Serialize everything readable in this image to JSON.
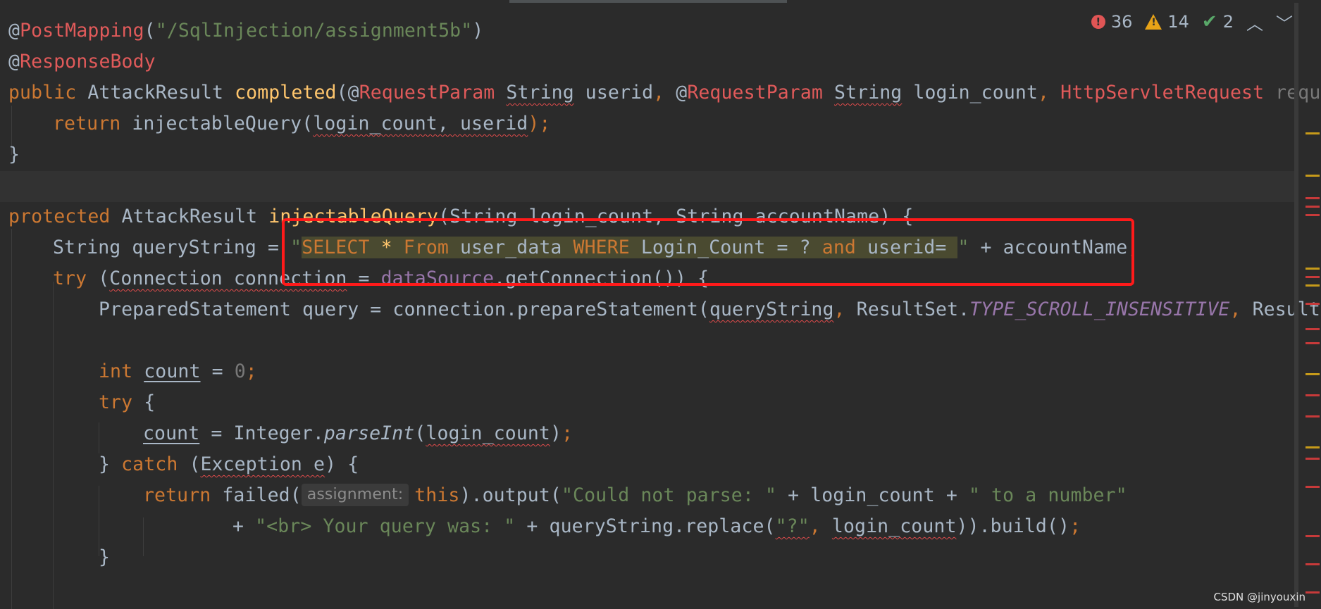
{
  "inspections": {
    "errors": "36",
    "warnings": "14",
    "weak_warnings": "2",
    "error_icon": "error-circle-icon",
    "warning_icon": "warning-triangle-icon",
    "weak_icon": "double-check-icon",
    "up_icon": "chevron-up-icon",
    "down_icon": "chevron-down-icon"
  },
  "code": {
    "l1_at": "@",
    "l1_ann": "PostMapping",
    "l1_open": "(",
    "l1_str": "\"/SqlInjection/assignment5b\"",
    "l1_close": ")",
    "l2_at": "@",
    "l2_ann": "ResponseBody",
    "l3_public": "public",
    "l3_type": " AttackResult ",
    "l3_fn": "completed",
    "l3_p1": "(@",
    "l3_ann1": "RequestParam",
    "l3_sp1": " ",
    "l3_string1": "String",
    "l3_userid": " userid",
    "l3_comma1": ",",
    "l3_p2": " @",
    "l3_ann2": "RequestParam",
    "l3_sp2": " ",
    "l3_string2": "String",
    "l3_lc": " login_count",
    "l3_comma2": ",",
    "l3_sp3": " ",
    "l3_hsr": "HttpServletRequest",
    "l3_req": " reque",
    "l4_return": "return",
    "l4_call": " injectableQuery(",
    "l4_args": "login_count, userid",
    "l4_end": ");",
    "l5_brace": "}",
    "l7_protected": "protected",
    "l7_type": " AttackResult ",
    "l7_fn": "injectableQuery",
    "l7_params": "(String login_count, String accountName) {",
    "l8_start": "String queryString = ",
    "l8_q1": "\"",
    "l8_select": "SELECT",
    "l8_star": " * ",
    "l8_from": "From",
    "l8_table": " user_data ",
    "l8_where": "WHERE",
    "l8_col": " Login_Count = ? ",
    "l8_and": "and",
    "l8_userid": " userid= ",
    "l8_q2": "\"",
    "l8_plus": " + accountName",
    "l8_semi": ";",
    "l9_try": "try",
    "l9_open": " (",
    "l9_conn": "Connection connection",
    "l9_eq": " = ",
    "l9_ds": "dataSource",
    "l9_rest": ".getConnection()) {",
    "l10_start": "PreparedStatement query = connection.prepareStatement(",
    "l10_qs": "queryString",
    "l10_comma": ",",
    "l10_rs": " ResultSet.",
    "l10_static": "TYPE_SCROLL_INSENSITIVE",
    "l10_comma2": ",",
    "l10_rs2": " ResultS",
    "l12_int": "int",
    "l12_sp": " ",
    "l12_count": "count",
    "l12_eq": " = ",
    "l12_zero": "0",
    "l12_semi": ";",
    "l13_try": "try",
    "l13_brace": " {",
    "l14_count": "count",
    "l14_mid": " = Integer.",
    "l14_parse": "parseInt",
    "l14_open": "(",
    "l14_arg": "login_count",
    "l14_close": ")",
    "l14_semi": ";",
    "l15_close": "} ",
    "l15_catch": "catch",
    "l15_open": " (",
    "l15_exc": "Exception e",
    "l15_end": ") {",
    "l16_return": "return",
    "l16_failed": " failed(",
    "l16_hint": "assignment:",
    "l16_this": "this",
    "l16_out": ").output(",
    "l16_str1": "\"Could not parse: \"",
    "l16_plus": " + login_count + ",
    "l16_str2": "\" to a number\"",
    "l17_plus": "+ ",
    "l17_str": "\"<br> Your query was: \"",
    "l17_mid": " + queryString.replace(",
    "l17_q": "\"?\"",
    "l17_comma": ",",
    "l17_sp": " ",
    "l17_lc": "login_count",
    "l17_end": ")).build()",
    "l17_semi": ";",
    "l18_brace": "}"
  },
  "watermark": "CSDN @jinyouxin",
  "highlight_color": "#ff1a1a"
}
